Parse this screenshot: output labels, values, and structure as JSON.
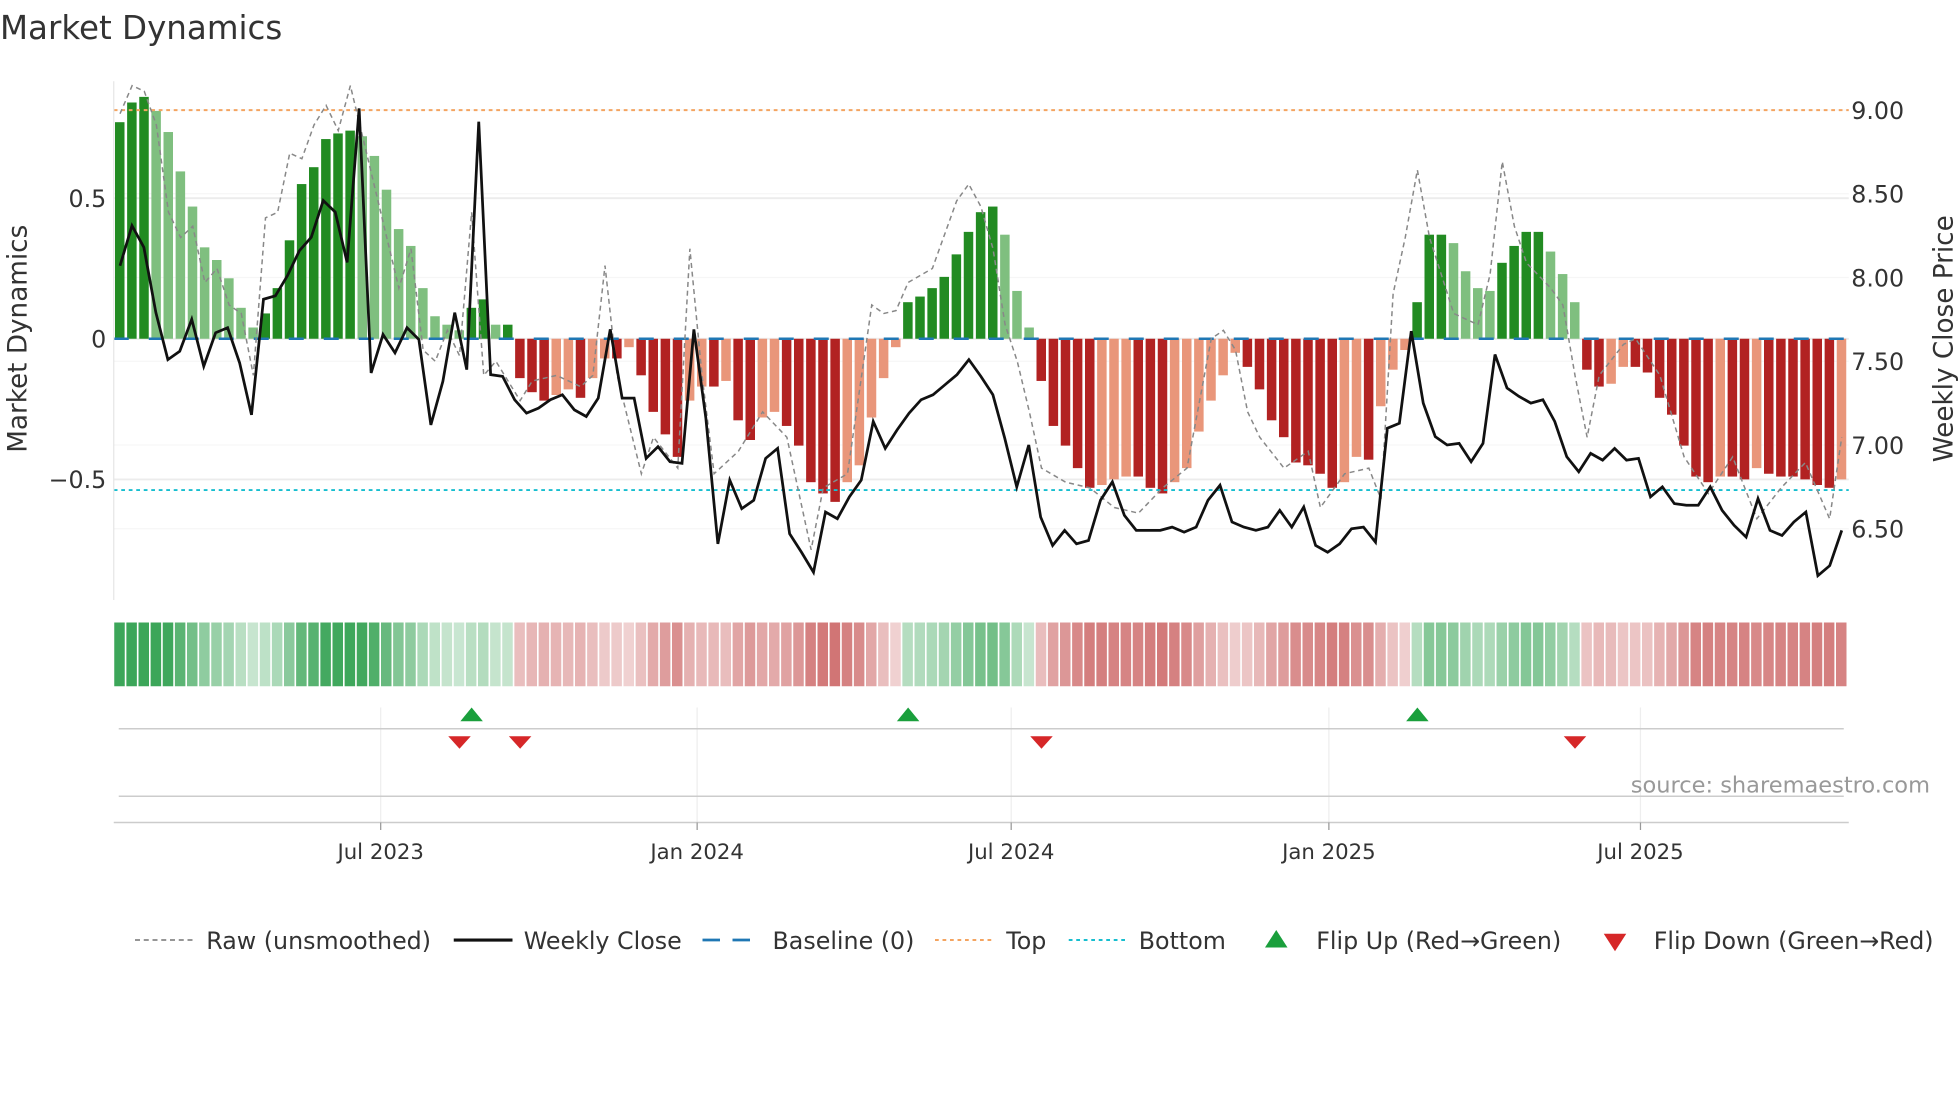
{
  "colors": {
    "dark_green": "#228b22",
    "light_green": "#7fbf7f",
    "dark_red": "#b22222",
    "light_red": "#e9967a",
    "baseline": "#1f77b4",
    "top": "#f4a460",
    "bottom": "#17becf",
    "flip_up": "#1a9f3c",
    "flip_down": "#d62728"
  },
  "chart_data": {
    "type": "bar",
    "title": "Market Dynamics",
    "ylabel": "Market Dynamics",
    "y2label": "Weekly Close Price",
    "ylim": [
      -0.93,
      0.92
    ],
    "y2lim": [
      6.0,
      9.2
    ],
    "yticks": [
      {
        "v": 0.5,
        "label": "0.5"
      },
      {
        "v": 0,
        "label": "0"
      },
      {
        "v": -0.5,
        "label": "−0.5"
      }
    ],
    "y2ticks": [
      {
        "v": 9.0,
        "label": "9.00"
      },
      {
        "v": 8.5,
        "label": "8.50"
      },
      {
        "v": 8.0,
        "label": "8.00"
      },
      {
        "v": 7.5,
        "label": "7.50"
      },
      {
        "v": 7.0,
        "label": "7.00"
      },
      {
        "v": 6.5,
        "label": "6.50"
      }
    ],
    "xticks": [
      {
        "week": 21.5,
        "label": "Jul 2023"
      },
      {
        "week": 47.6,
        "label": "Jan 2024"
      },
      {
        "week": 73.5,
        "label": "Jul 2024"
      },
      {
        "week": 99.7,
        "label": "Jan 2025"
      },
      {
        "week": 125.4,
        "label": "Jul 2025"
      }
    ],
    "top_level": 0.813,
    "bottom_level": -0.538,
    "baseline": 0,
    "market_dynamics": [
      0.77,
      0.84,
      0.86,
      0.81,
      0.735,
      0.595,
      0.47,
      0.325,
      0.28,
      0.215,
      0.11,
      0.04,
      0.09,
      0.18,
      0.35,
      0.55,
      0.61,
      0.71,
      0.73,
      0.74,
      0.72,
      0.65,
      0.53,
      0.39,
      0.33,
      0.18,
      0.08,
      0.05,
      0.03,
      0.11,
      0.14,
      0.05,
      0.05,
      -0.14,
      -0.19,
      -0.22,
      -0.2,
      -0.18,
      -0.21,
      -0.14,
      -0.07,
      -0.07,
      -0.03,
      -0.13,
      -0.26,
      -0.34,
      -0.42,
      -0.22,
      -0.17,
      -0.17,
      -0.15,
      -0.29,
      -0.36,
      -0.28,
      -0.26,
      -0.31,
      -0.38,
      -0.51,
      -0.55,
      -0.58,
      -0.51,
      -0.45,
      -0.28,
      -0.14,
      -0.03,
      0.13,
      0.15,
      0.18,
      0.22,
      0.3,
      0.38,
      0.45,
      0.47,
      0.37,
      0.17,
      0.04,
      -0.15,
      -0.31,
      -0.38,
      -0.46,
      -0.53,
      -0.52,
      -0.5,
      -0.49,
      -0.49,
      -0.53,
      -0.55,
      -0.51,
      -0.46,
      -0.33,
      -0.22,
      -0.13,
      -0.05,
      -0.1,
      -0.18,
      -0.29,
      -0.35,
      -0.44,
      -0.45,
      -0.48,
      -0.53,
      -0.51,
      -0.42,
      -0.43,
      -0.24,
      -0.11,
      -0.04,
      0.13,
      0.37,
      0.37,
      0.34,
      0.24,
      0.18,
      0.17,
      0.27,
      0.33,
      0.38,
      0.38,
      0.31,
      0.23,
      0.13,
      -0.11,
      -0.17,
      -0.16,
      -0.1,
      -0.1,
      -0.12,
      -0.21,
      -0.27,
      -0.38,
      -0.49,
      -0.51,
      -0.49,
      -0.49,
      -0.5,
      -0.46,
      -0.48,
      -0.49,
      -0.49,
      -0.5,
      -0.52,
      -0.53,
      -0.5
    ],
    "weekly_close": [
      8.07,
      8.31,
      8.18,
      7.79,
      7.51,
      7.56,
      7.75,
      7.47,
      7.67,
      7.7,
      7.49,
      7.18,
      7.87,
      7.89,
      8.01,
      8.16,
      8.24,
      8.46,
      8.39,
      8.09,
      9.01,
      7.43,
      7.66,
      7.55,
      7.7,
      7.63,
      7.12,
      7.38,
      7.79,
      7.45,
      8.93,
      7.42,
      7.41,
      7.27,
      7.19,
      7.22,
      7.27,
      7.3,
      7.21,
      7.17,
      7.28,
      7.69,
      7.28,
      7.28,
      6.92,
      6.99,
      6.9,
      6.89,
      7.69,
      7.16,
      6.41,
      6.79,
      6.62,
      6.67,
      6.92,
      6.98,
      6.47,
      6.36,
      6.24,
      6.6,
      6.56,
      6.69,
      6.79,
      7.14,
      6.98,
      7.09,
      7.19,
      7.27,
      7.3,
      7.36,
      7.42,
      7.51,
      7.41,
      7.3,
      7.04,
      6.75,
      7.0,
      6.57,
      6.4,
      6.49,
      6.41,
      6.43,
      6.67,
      6.78,
      6.58,
      6.49,
      6.49,
      6.49,
      6.51,
      6.48,
      6.51,
      6.67,
      6.76,
      6.54,
      6.51,
      6.49,
      6.51,
      6.61,
      6.51,
      6.63,
      6.4,
      6.36,
      6.41,
      6.5,
      6.51,
      6.42,
      7.1,
      7.13,
      7.68,
      7.25,
      7.05,
      7.0,
      7.01,
      6.9,
      7.01,
      7.54,
      7.34,
      7.29,
      7.25,
      7.27,
      7.14,
      6.93,
      6.84,
      6.95,
      6.91,
      6.98,
      6.91,
      6.92,
      6.69,
      6.75,
      6.65,
      6.64,
      6.64,
      6.75,
      6.61,
      6.52,
      6.45,
      6.68,
      6.49,
      6.46,
      6.54,
      6.6,
      6.22,
      6.28,
      6.49
    ],
    "raw_unsmoothed": [
      [
        0,
        0.8
      ],
      [
        1,
        0.9
      ],
      [
        2,
        0.88
      ],
      [
        3,
        0.76
      ],
      [
        4,
        0.45
      ],
      [
        5,
        0.36
      ],
      [
        6,
        0.4
      ],
      [
        7,
        0.2
      ],
      [
        8,
        0.25
      ],
      [
        9,
        0.12
      ],
      [
        10,
        0.09
      ],
      [
        11,
        -0.13
      ],
      [
        12,
        0.43
      ],
      [
        13,
        0.45
      ],
      [
        14,
        0.66
      ],
      [
        15,
        0.64
      ],
      [
        16,
        0.76
      ],
      [
        17,
        0.83
      ],
      [
        18,
        0.74
      ],
      [
        19,
        0.9
      ],
      [
        20,
        0.72
      ],
      [
        21,
        0.54
      ],
      [
        22,
        0.36
      ],
      [
        23,
        0.18
      ],
      [
        24,
        0.32
      ],
      [
        25,
        -0.04
      ],
      [
        26,
        -0.08
      ],
      [
        27,
        0.03
      ],
      [
        28,
        -0.06
      ],
      [
        29,
        0.45
      ],
      [
        30,
        -0.13
      ],
      [
        31,
        -0.08
      ],
      [
        33,
        -0.22
      ],
      [
        34,
        -0.15
      ],
      [
        36,
        -0.13
      ],
      [
        38,
        -0.17
      ],
      [
        39,
        -0.13
      ],
      [
        40,
        0.26
      ],
      [
        41,
        -0.13
      ],
      [
        43,
        -0.48
      ],
      [
        44,
        -0.35
      ],
      [
        46,
        -0.46
      ],
      [
        47,
        0.32
      ],
      [
        48,
        -0.13
      ],
      [
        49,
        -0.48
      ],
      [
        51,
        -0.4
      ],
      [
        53,
        -0.26
      ],
      [
        55,
        -0.35
      ],
      [
        57,
        -0.75
      ],
      [
        58,
        -0.53
      ],
      [
        60,
        -0.48
      ],
      [
        62,
        0.12
      ],
      [
        63,
        0.09
      ],
      [
        64,
        0.1
      ],
      [
        65,
        0.2
      ],
      [
        67,
        0.25
      ],
      [
        69,
        0.49
      ],
      [
        70,
        0.55
      ],
      [
        71,
        0.47
      ],
      [
        72,
        0.32
      ],
      [
        73,
        0.05
      ],
      [
        74,
        -0.08
      ],
      [
        75,
        -0.26
      ],
      [
        76,
        -0.46
      ],
      [
        78,
        -0.51
      ],
      [
        80,
        -0.53
      ],
      [
        82,
        -0.6
      ],
      [
        84,
        -0.62
      ],
      [
        86,
        -0.53
      ],
      [
        88,
        -0.46
      ],
      [
        90,
        0.0
      ],
      [
        91,
        0.03
      ],
      [
        92,
        -0.04
      ],
      [
        93,
        -0.26
      ],
      [
        94,
        -0.35
      ],
      [
        96,
        -0.46
      ],
      [
        98,
        -0.4
      ],
      [
        99,
        -0.6
      ],
      [
        101,
        -0.48
      ],
      [
        103,
        -0.46
      ],
      [
        104,
        -0.57
      ],
      [
        105,
        0.16
      ],
      [
        106,
        0.36
      ],
      [
        107,
        0.6
      ],
      [
        108,
        0.36
      ],
      [
        110,
        0.09
      ],
      [
        112,
        0.05
      ],
      [
        113,
        0.23
      ],
      [
        114,
        0.63
      ],
      [
        115,
        0.4
      ],
      [
        116,
        0.27
      ],
      [
        118,
        0.18
      ],
      [
        119,
        0.12
      ],
      [
        120,
        -0.13
      ],
      [
        121,
        -0.35
      ],
      [
        122,
        -0.13
      ],
      [
        124,
        -0.02
      ],
      [
        125,
        0.0
      ],
      [
        127,
        -0.13
      ],
      [
        129,
        -0.42
      ],
      [
        131,
        -0.55
      ],
      [
        133,
        -0.42
      ],
      [
        135,
        -0.64
      ],
      [
        137,
        -0.53
      ],
      [
        139,
        -0.44
      ],
      [
        141,
        -0.64
      ],
      [
        142,
        -0.35
      ]
    ],
    "flip_up_weeks": [
      29,
      65,
      107
    ],
    "flip_down_weeks": [
      28,
      33,
      76,
      120
    ],
    "legend": {
      "placement": "bottom",
      "raw": "Raw (unsmoothed)",
      "close": "Weekly Close",
      "baseline": "Baseline (0)",
      "top": "Top",
      "bottom": "Bottom",
      "flip_up": "Flip Up (Red→Green)",
      "flip_down": "Flip Down (Green→Red)"
    },
    "source": "source: sharemaestro.com"
  }
}
